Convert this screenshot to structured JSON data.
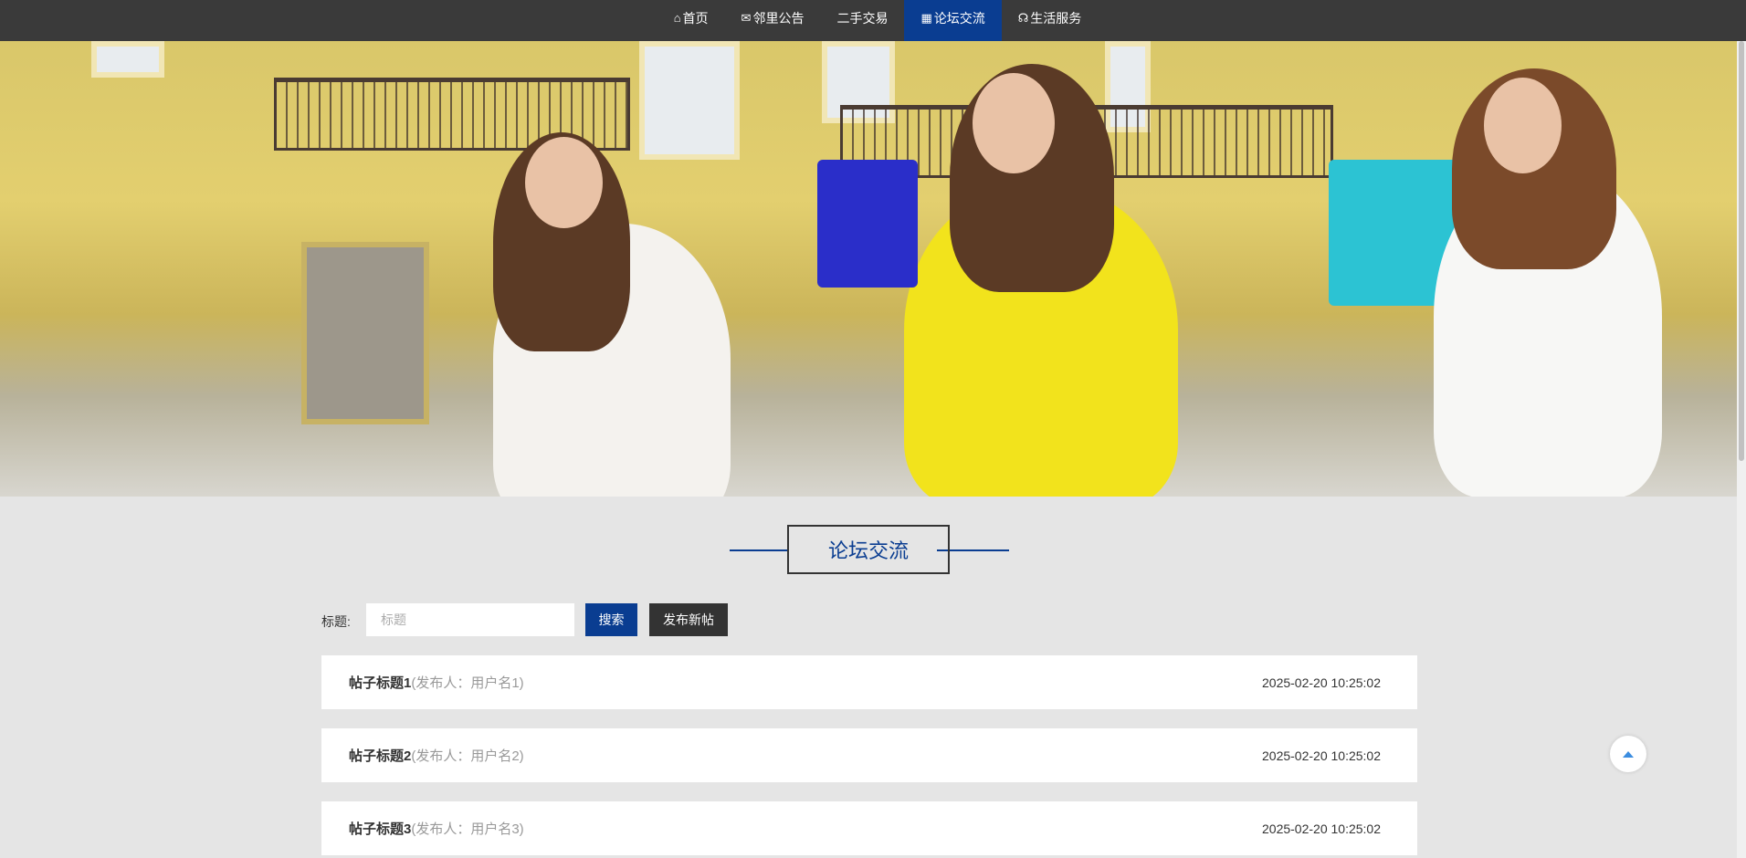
{
  "nav": {
    "items": [
      {
        "label": "首页",
        "icon": "home-icon",
        "glyph": "⌂"
      },
      {
        "label": "邻里公告",
        "icon": "envelope-icon",
        "glyph": "✉"
      },
      {
        "label": "二手交易",
        "icon": "",
        "glyph": ""
      },
      {
        "label": "论坛交流",
        "icon": "grid-icon",
        "glyph": "▦",
        "active": true
      },
      {
        "label": "生活服务",
        "icon": "headset-icon",
        "glyph": "☊"
      }
    ]
  },
  "section": {
    "title": "论坛交流"
  },
  "search": {
    "label": "标题:",
    "placeholder": "标题",
    "search_label": "搜索",
    "post_label": "发布新帖"
  },
  "posts": [
    {
      "title": "帖子标题1",
      "author": "(发布人：用户名1)",
      "date": "2025-02-20 10:25:02"
    },
    {
      "title": "帖子标题2",
      "author": "(发布人：用户名2)",
      "date": "2025-02-20 10:25:02"
    },
    {
      "title": "帖子标题3",
      "author": "(发布人：用户名3)",
      "date": "2025-02-20 10:25:02"
    }
  ],
  "colors": {
    "accent": "#0a3d91",
    "nav_bg": "#3a3a3a",
    "page_bg": "#e5e5e5"
  }
}
